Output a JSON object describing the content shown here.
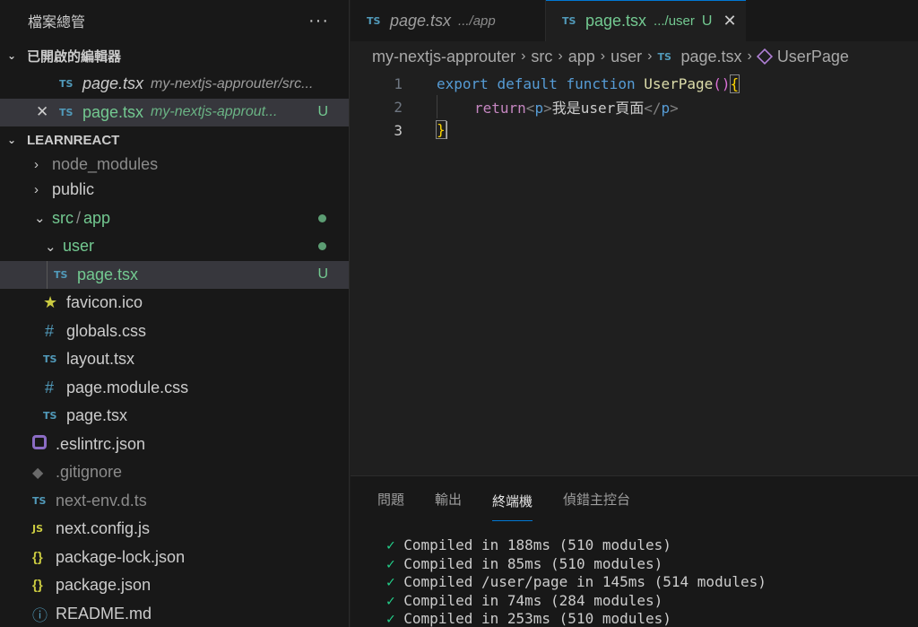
{
  "sidebar": {
    "title": "檔案總管",
    "more": "···",
    "open_editors": {
      "title": "已開啟的編輯器",
      "items": [
        {
          "icon": "TS",
          "name": "page.tsx",
          "desc": "my-nextjs-approuter/src..."
        },
        {
          "icon": "TS",
          "name": "page.tsx",
          "desc": "my-nextjs-approut...",
          "badge": "U"
        }
      ]
    },
    "project": {
      "title": "LEARNREACT",
      "items": [
        {
          "name": "node_modules"
        },
        {
          "name": "public"
        },
        {
          "name": "src",
          "sep": "/",
          "name2": "app"
        },
        {
          "name": "user"
        },
        {
          "icon": "TS",
          "name": "page.tsx",
          "badge": "U"
        },
        {
          "name": "favicon.ico"
        },
        {
          "icon": "#",
          "name": "globals.css"
        },
        {
          "icon": "TS",
          "name": "layout.tsx"
        },
        {
          "icon": "#",
          "name": "page.module.css"
        },
        {
          "icon": "TS",
          "name": "page.tsx"
        },
        {
          "name": ".eslintrc.json"
        },
        {
          "name": ".gitignore"
        },
        {
          "icon": "TS",
          "name": "next-env.d.ts"
        },
        {
          "icon": "JS",
          "name": "next.config.js"
        },
        {
          "icon": "{}",
          "name": "package-lock.json"
        },
        {
          "icon": "{}",
          "name": "package.json"
        },
        {
          "name": "README.md"
        }
      ]
    }
  },
  "tabs": [
    {
      "icon": "TS",
      "name": "page.tsx",
      "desc": ".../app"
    },
    {
      "icon": "TS",
      "name": "page.tsx",
      "desc": ".../user",
      "badge": "U"
    }
  ],
  "breadcrumbs": [
    "my-nextjs-approuter",
    "src",
    "app",
    "user",
    "page.tsx",
    "UserPage"
  ],
  "breadcrumb_ts_icon": "TS",
  "code": {
    "line_numbers": [
      "1",
      "2",
      "3"
    ],
    "line1": {
      "export": "export",
      "default": "default",
      "function": "function",
      "name": "UserPage",
      "parens": "()",
      "brace": "{"
    },
    "line2": {
      "return": "return",
      "open_tag_lt": "<",
      "open_tag": "p",
      "open_tag_gt": ">",
      "text": "我是user頁面",
      "close_tag_lt": "</",
      "close_tag": "p",
      "close_tag_gt": ">"
    },
    "line3": {
      "brace": "}"
    }
  },
  "panel": {
    "tabs": [
      "問題",
      "輸出",
      "終端機",
      "偵錯主控台"
    ],
    "terminal_lines": [
      "Compiled in 188ms (510 modules)",
      "Compiled in 85ms (510 modules)",
      "Compiled /user/page in 145ms (514 modules)",
      "Compiled in 74ms (284 modules)",
      "Compiled in 253ms (510 modules)"
    ],
    "check": "✓"
  }
}
